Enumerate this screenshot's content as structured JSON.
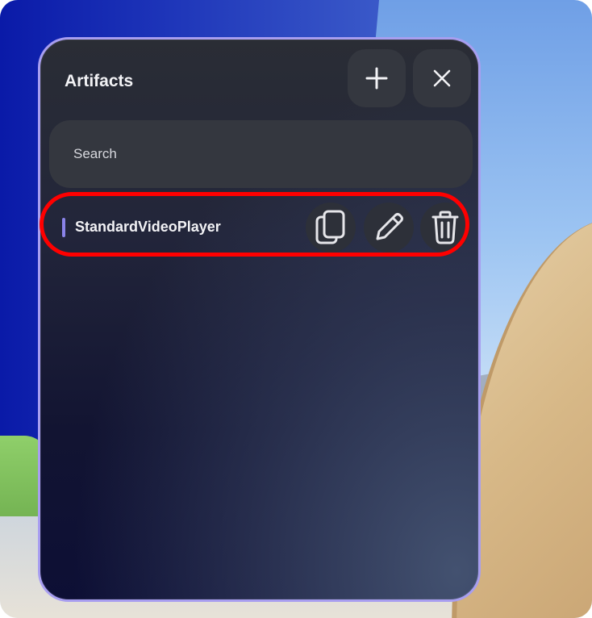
{
  "panel": {
    "title": "Artifacts",
    "add_icon": "plus-icon",
    "close_icon": "close-icon"
  },
  "search": {
    "placeholder": "Search"
  },
  "artifacts": [
    {
      "name": "StandardVideoPlayer",
      "actions": [
        "copy-icon",
        "edit-icon",
        "delete-icon"
      ]
    }
  ],
  "colors": {
    "accent": "#8a83e8",
    "panel_border": "#a89ef0",
    "highlight": "#ff0000"
  }
}
